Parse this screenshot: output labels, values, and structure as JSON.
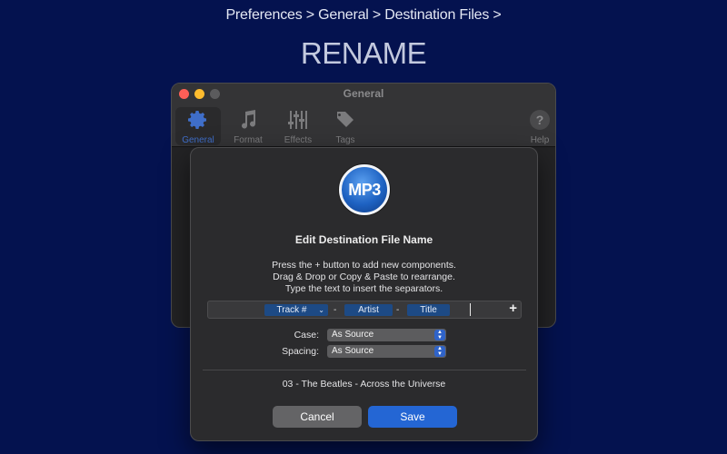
{
  "header": {
    "breadcrumb": "Preferences > General > Destination Files >",
    "headline": "RENAME"
  },
  "window": {
    "title": "General",
    "toolbar": [
      {
        "label": "General",
        "icon": "gear-icon",
        "selected": true
      },
      {
        "label": "Format",
        "icon": "music-note-icon"
      },
      {
        "label": "Effects",
        "icon": "sliders-icon"
      },
      {
        "label": "Tags",
        "icon": "tag-icon"
      },
      {
        "label": "Help",
        "icon": "help-icon"
      }
    ]
  },
  "dialog": {
    "badge_text": "MP3",
    "title": "Edit Destination File Name",
    "instructions": [
      "Press the + button to add new components.",
      "Drag & Drop or Copy & Paste to rearrange.",
      "Type the text to insert the separators."
    ],
    "tokens": [
      {
        "label": "Track #",
        "has_dropdown": true
      },
      {
        "label": "Artist"
      },
      {
        "label": "Title"
      }
    ],
    "separators": [
      "-",
      "-"
    ],
    "add_button": "+",
    "case_label": "Case:",
    "case_value": "As Source",
    "spacing_label": "Spacing:",
    "spacing_value": "As Source",
    "preview": "03 - The Beatles - Across the Universe",
    "cancel_label": "Cancel",
    "save_label": "Save"
  },
  "colors": {
    "background": "#04124f",
    "accent": "#2466d4",
    "token_bg": "#1d4a85"
  }
}
